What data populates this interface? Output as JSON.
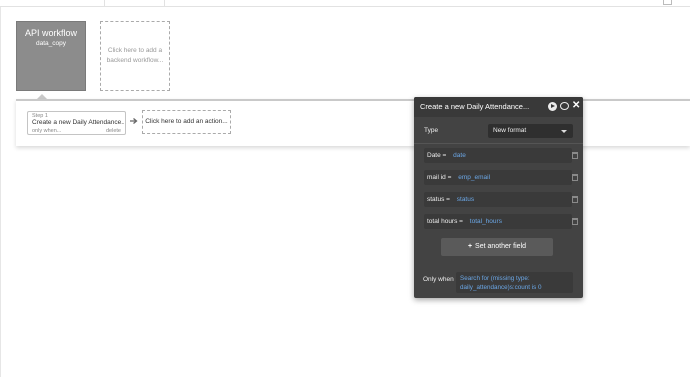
{
  "workflow": {
    "title": "API workflow",
    "subtitle": "data_copy"
  },
  "add_backend": {
    "label": "Click here to add a backend workflow..."
  },
  "step": {
    "label": "Step 1",
    "name": "Create a new Daily Attendance...",
    "only_when": "only when...",
    "delete": "delete"
  },
  "add_action": {
    "label": "Click here to add an action..."
  },
  "panel": {
    "title": "Create a new Daily Attendance...",
    "type_label": "Type",
    "type_value": "New format",
    "fields": [
      {
        "name": "Date",
        "eq": "=",
        "value": "date"
      },
      {
        "name": "mail id",
        "eq": "=",
        "value": "emp_email"
      },
      {
        "name": "status",
        "eq": "=",
        "value": "status"
      },
      {
        "name": "total hours",
        "eq": "=",
        "value": "total_hours"
      }
    ],
    "set_another": "Set another field",
    "only_when_label": "Only when",
    "only_when_expr": "Search for (missing type: daily_attendance)s:count is 0"
  },
  "colors": {
    "panel_bg": "#434343",
    "expression_blue": "#6ba7e6",
    "workflow_tile": "#8c8c8c"
  }
}
